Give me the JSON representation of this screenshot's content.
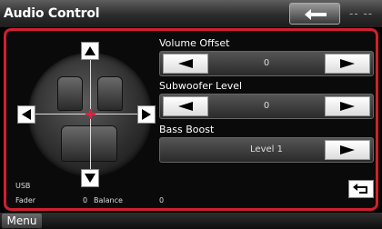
{
  "header": {
    "title": "Audio Control",
    "right_text": "-- --"
  },
  "fader": {
    "source": "USB",
    "fader_label": "Fader",
    "fader_value": "0",
    "balance_label": "Balance",
    "balance_value": "0"
  },
  "controls": [
    {
      "label": "Volume Offset",
      "value": "0"
    },
    {
      "label": "Subwoofer Level",
      "value": "0"
    },
    {
      "label": "Bass Boost",
      "value": "Level 1"
    }
  ],
  "menu": {
    "label": "Menu"
  },
  "colors": {
    "highlight": "#d02030",
    "cursor": "#e02040"
  },
  "icons": [
    "back-arrow-icon",
    "arrow-up-icon",
    "arrow-down-icon",
    "arrow-left-icon",
    "arrow-right-icon",
    "return-icon"
  ]
}
